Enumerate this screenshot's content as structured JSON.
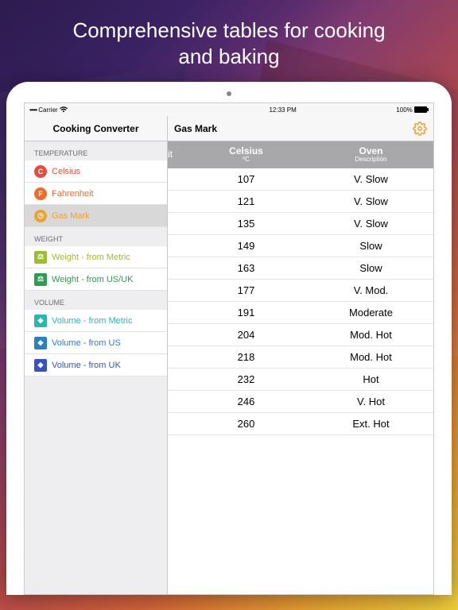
{
  "hero": {
    "line1": "Comprehensive tables for cooking",
    "line2": "and baking"
  },
  "status": {
    "carrier": "Carrier",
    "time": "12:33 PM",
    "battery": "100%"
  },
  "nav": {
    "left_title": "Cooking Converter",
    "right_title": "Gas Mark"
  },
  "sidebar": {
    "sections": [
      {
        "header": "TEMPERATURE",
        "items": [
          {
            "label": "Celsius",
            "icon": "C",
            "color": "#e74c3c",
            "text_color": "#e74c3c",
            "round": true,
            "selected": false
          },
          {
            "label": "Fahrenheit",
            "icon": "F",
            "color": "#f06a2a",
            "text_color": "#f06a2a",
            "round": true,
            "selected": false
          },
          {
            "label": "Gas Mark",
            "icon": "◷",
            "color": "#f0a030",
            "text_color": "#f0a030",
            "round": true,
            "selected": true
          }
        ]
      },
      {
        "header": "WEIGHT",
        "items": [
          {
            "label": "Weight - from Metric",
            "icon": "⚖",
            "color": "#9bbf2e",
            "text_color": "#9bbf2e",
            "round": false,
            "selected": false
          },
          {
            "label": "Weight - from US/UK",
            "icon": "⚖",
            "color": "#2e9b4f",
            "text_color": "#2e9b4f",
            "round": false,
            "selected": false
          }
        ]
      },
      {
        "header": "VOLUME",
        "items": [
          {
            "label": "Volume - from Metric",
            "icon": "◆",
            "color": "#2ab7b0",
            "text_color": "#2ab7b0",
            "round": false,
            "selected": false
          },
          {
            "label": "Volume - from US",
            "icon": "◆",
            "color": "#2a7ec9",
            "text_color": "#2a7ec9",
            "round": false,
            "selected": false
          },
          {
            "label": "Volume - from UK",
            "icon": "◆",
            "color": "#3552c9",
            "text_color": "#3552c9",
            "round": false,
            "selected": false
          }
        ]
      }
    ]
  },
  "table": {
    "truncated_col": "it",
    "columns": [
      {
        "title": "Celsius",
        "sub": "ºC"
      },
      {
        "title": "Oven",
        "sub": "Description"
      }
    ],
    "rows": [
      {
        "c": "107",
        "d": "V. Slow"
      },
      {
        "c": "121",
        "d": "V. Slow"
      },
      {
        "c": "135",
        "d": "V. Slow"
      },
      {
        "c": "149",
        "d": "Slow"
      },
      {
        "c": "163",
        "d": "Slow"
      },
      {
        "c": "177",
        "d": "V. Mod."
      },
      {
        "c": "191",
        "d": "Moderate"
      },
      {
        "c": "204",
        "d": "Mod. Hot"
      },
      {
        "c": "218",
        "d": "Mod. Hot"
      },
      {
        "c": "232",
        "d": "Hot"
      },
      {
        "c": "246",
        "d": "V. Hot"
      },
      {
        "c": "260",
        "d": "Ext. Hot"
      }
    ]
  }
}
